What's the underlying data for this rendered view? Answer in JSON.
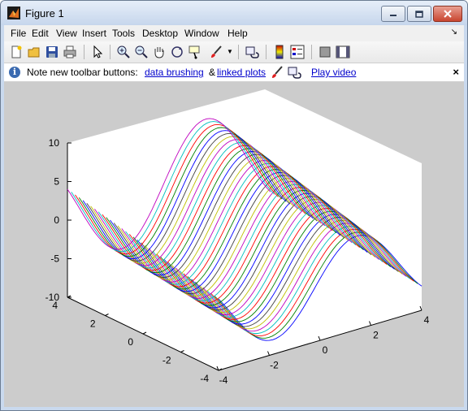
{
  "window": {
    "title": "Figure 1",
    "menu": [
      "File",
      "Edit",
      "View",
      "Insert",
      "Tools",
      "Desktop",
      "Window",
      "Help"
    ],
    "minimize_icon": "minimize-icon",
    "maximize_icon": "maximize-icon",
    "close_icon": "close-icon"
  },
  "toolbar": {
    "buttons": [
      "new-figure-icon",
      "open-file-icon",
      "save-icon",
      "print-icon",
      "edit-plot-arrow-icon",
      "zoom-in-icon",
      "zoom-out-icon",
      "pan-hand-icon",
      "rotate-3d-icon",
      "data-cursor-icon",
      "brush-icon",
      "brush-dropdown-icon",
      "link-plot-icon",
      "insert-colorbar-icon",
      "insert-legend-icon",
      "hide-plot-tools-icon",
      "show-plot-tools-icon"
    ]
  },
  "infobar": {
    "text": "Note new toolbar buttons:",
    "link_brushing": "data brushing",
    "amp": "&",
    "link_plots": "linked plots",
    "link_video": "Play video",
    "close": "×"
  },
  "chart_data": {
    "type": "line",
    "description_func": "mesh lines of a saddle-like surface z = x^2 - y^2 style, plotted with plot3 over x,y in [-4,4]",
    "x_range": [
      -4,
      4
    ],
    "y_range": [
      -4,
      4
    ],
    "zlim": [
      -10,
      10
    ],
    "x_ticks": [
      "-4",
      "-2",
      "0",
      "2",
      "4"
    ],
    "y_ticks": [
      "-4",
      "-2",
      "0",
      "2",
      "4"
    ],
    "z_ticks": [
      "-10",
      "-5",
      "0",
      "5",
      "10"
    ],
    "num_series": 40,
    "colors": [
      "#0000ff",
      "#008000",
      "#ff0000",
      "#00bfbf",
      "#bf00bf",
      "#bfbf00",
      "#404040"
    ],
    "grid": false,
    "title": "",
    "xlabel": "",
    "ylabel": "",
    "zlabel": ""
  }
}
